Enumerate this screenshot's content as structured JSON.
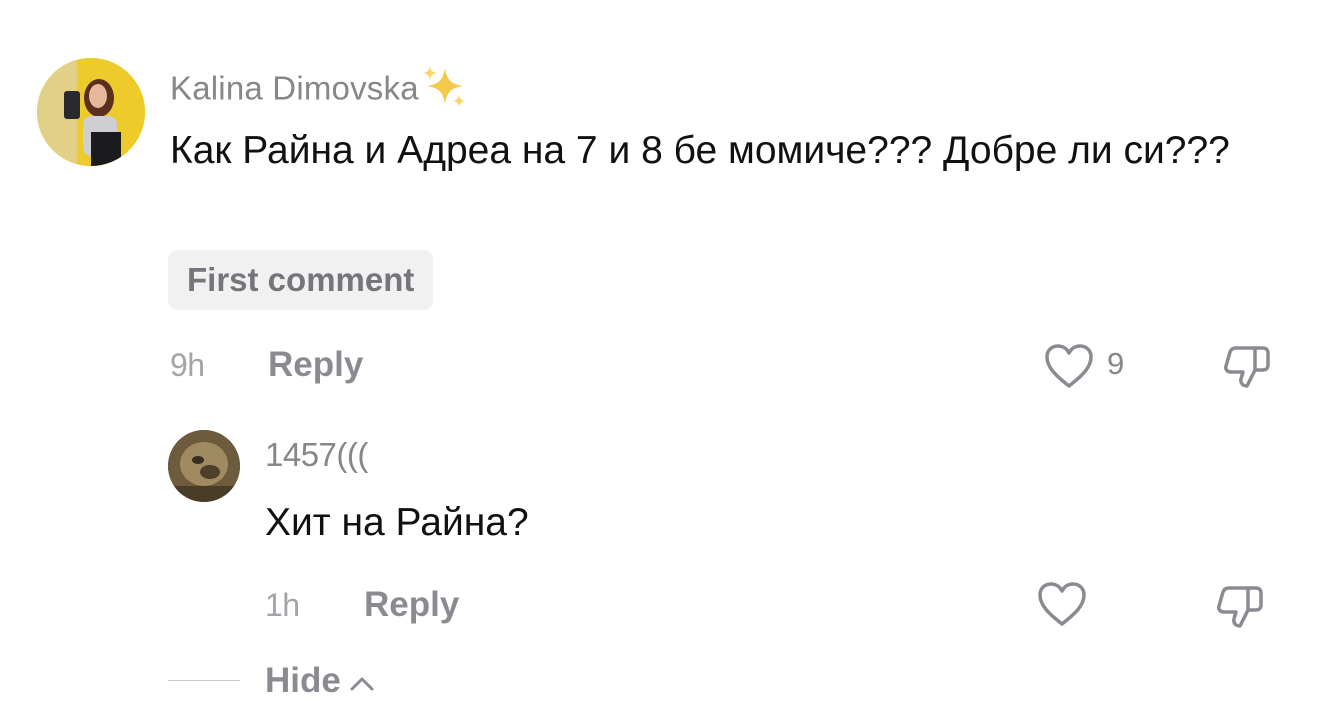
{
  "comment": {
    "username": "Kalina Dimovska",
    "username_suffix_icon": "sparkles-icon",
    "text": "Как Райна и Адреа на 7 и 8 бе момиче??? Добре ли си???",
    "badge": "First comment",
    "time": "9h",
    "reply_label": "Reply",
    "like_count": "9",
    "like_icon": "heart-outline-icon",
    "dislike_icon": "thumbs-down-icon"
  },
  "reply": {
    "username": "1457(((",
    "text": "Хит на Райна?",
    "time": "1h",
    "reply_label": "Reply",
    "like_icon": "heart-outline-icon",
    "dislike_icon": "thumbs-down-icon"
  },
  "hide": {
    "label": "Hide",
    "icon": "chevron-up-icon"
  },
  "colors": {
    "username": "#86878b",
    "text": "#111111",
    "muted": "#8a8b90",
    "badge_bg": "#f1f1f2",
    "sparkle": "#f5c94a"
  }
}
